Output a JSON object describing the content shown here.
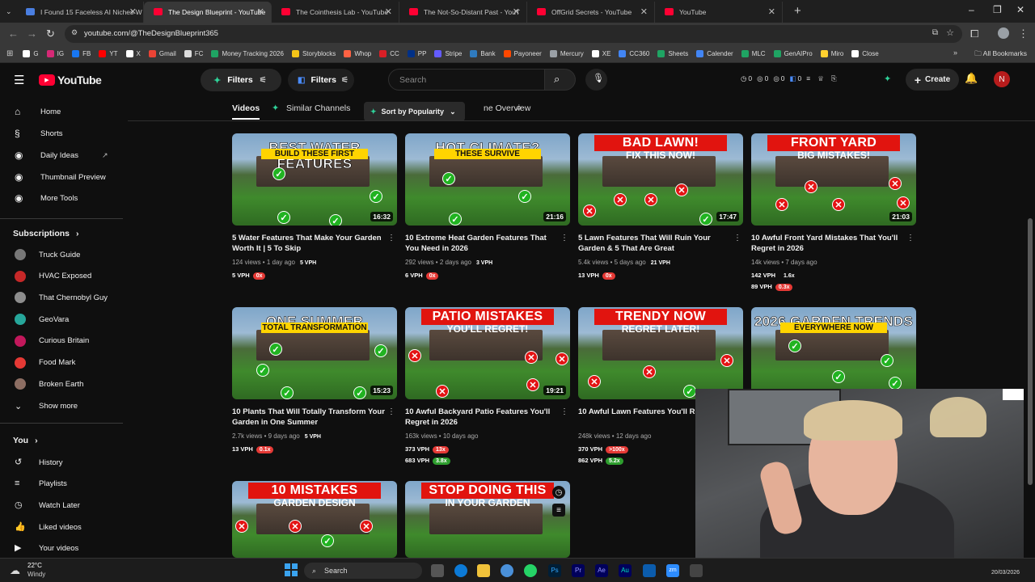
{
  "browser": {
    "tabs": [
      {
        "title": "I Found 15 Faceless AI Niches W",
        "active": false,
        "favicon": "doc-icon"
      },
      {
        "title": "The Design Blueprint - YouTube",
        "active": true,
        "favicon": "youtube-icon"
      },
      {
        "title": "The Cointhesis Lab - YouTube",
        "active": false,
        "favicon": "youtube-icon"
      },
      {
        "title": "The Not-So-Distant Past - YouT",
        "active": false,
        "favicon": "youtube-icon"
      },
      {
        "title": "OffGrid Secrets - YouTube",
        "active": false,
        "favicon": "youtube-icon"
      },
      {
        "title": "YouTube",
        "active": false,
        "favicon": "youtube-icon"
      }
    ],
    "url": "youtube.com/@TheDesignBlueprint365",
    "bookmarks": [
      {
        "label": "G",
        "color": "#ffffff"
      },
      {
        "label": "IG",
        "color": "#d62976"
      },
      {
        "label": "FB",
        "color": "#1877f2"
      },
      {
        "label": "YT",
        "color": "#ff0000"
      },
      {
        "label": "X",
        "color": "#ffffff"
      },
      {
        "label": "Gmail",
        "color": "#ea4335"
      },
      {
        "label": "FC",
        "color": "#dddddd"
      },
      {
        "label": "Money Tracking 2026",
        "color": "#1fa463"
      },
      {
        "label": "Storyblocks",
        "color": "#f5c518"
      },
      {
        "label": "Whop",
        "color": "#ff6243"
      },
      {
        "label": "CC",
        "color": "#da1f26"
      },
      {
        "label": "PP",
        "color": "#003087"
      },
      {
        "label": "Stripe",
        "color": "#635bff"
      },
      {
        "label": "Bank",
        "color": "#2f7bbf"
      },
      {
        "label": "Payoneer",
        "color": "#ff4800"
      },
      {
        "label": "Mercury",
        "color": "#9aa0a6"
      },
      {
        "label": "XE",
        "color": "#ffffff"
      },
      {
        "label": "CC360",
        "color": "#4285f4"
      },
      {
        "label": "Sheets",
        "color": "#1fa463"
      },
      {
        "label": "Calender",
        "color": "#4285f4"
      },
      {
        "label": "MLC",
        "color": "#1fa463"
      },
      {
        "label": "GenAIPro",
        "color": "#1fa463"
      },
      {
        "label": "Miro",
        "color": "#ffd02f"
      },
      {
        "label": "Close",
        "color": "#ffffff"
      }
    ],
    "all_bookmarks": "All Bookmarks"
  },
  "header": {
    "logo": "YouTube",
    "filters_a": "Filters",
    "filters_b": "Filters",
    "search_placeholder": "Search",
    "counters": [
      "0",
      "0",
      "0",
      "0"
    ],
    "create": "Create",
    "avatar_initial": "N"
  },
  "sidebar": {
    "main": [
      {
        "label": "Home",
        "icon": "home-icon"
      },
      {
        "label": "Shorts",
        "icon": "shorts-icon"
      },
      {
        "label": "Daily Ideas",
        "icon": "ideas-icon"
      },
      {
        "label": "Thumbnail Preview",
        "icon": "thumbnail-icon"
      },
      {
        "label": "More Tools",
        "icon": "tools-icon"
      }
    ],
    "subscriptions_title": "Subscriptions",
    "subscriptions": [
      {
        "label": "Truck Guide",
        "color": "#777777"
      },
      {
        "label": "HVAC Exposed",
        "color": "#c62828"
      },
      {
        "label": "That Chernobyl Guy",
        "color": "#8d8d8d"
      },
      {
        "label": "GeoVara",
        "color": "#26a69a"
      },
      {
        "label": "Curious Britain",
        "color": "#c2185b"
      },
      {
        "label": "Food Mark",
        "color": "#e53935"
      },
      {
        "label": "Broken Earth",
        "color": "#8d6e63"
      }
    ],
    "show_more": "Show more",
    "you_title": "You",
    "you_items": [
      {
        "label": "History",
        "icon": "history-icon"
      },
      {
        "label": "Playlists",
        "icon": "playlists-icon"
      },
      {
        "label": "Watch Later",
        "icon": "watch-later-icon"
      },
      {
        "label": "Liked videos",
        "icon": "like-icon"
      },
      {
        "label": "Your videos",
        "icon": "your-videos-icon"
      }
    ]
  },
  "channel_tabs": {
    "videos": "Videos",
    "similar": "Similar Channels",
    "sort": "Sort by Popularity",
    "overview": "ne Overview"
  },
  "videos": [
    {
      "headline1": "BEST WATER FEATURES",
      "headline2": "BUILD THESE FIRST",
      "duration": "16:32",
      "title": "5 Water Features That Make Your Garden Worth It | 5 To Skip",
      "views": "124 views",
      "age": "1 day ago",
      "vph": "5 VPH",
      "stats": [
        {
          "text": "5 VPH",
          "badge": "0x",
          "badge_color": "red"
        }
      ]
    },
    {
      "headline1": "HOT CLIMATE?",
      "headline2": "THESE SURVIVE",
      "duration": "21:16",
      "title": "10 Extreme Heat Garden Features That You Need in 2026",
      "views": "292 views",
      "age": "2 days ago",
      "vph": "3 VPH",
      "stats": [
        {
          "text": "6 VPH",
          "badge": "0x",
          "badge_color": "red"
        }
      ]
    },
    {
      "headline1": "BAD LAWN!",
      "headline2": "FIX THIS NOW!",
      "duration": "17:47",
      "title": "5 Lawn Features That Will Ruin Your Garden & 5 That Are Great",
      "views": "5.4k views",
      "age": "5 days ago",
      "vph": "21 VPH",
      "stats": [
        {
          "text": "13 VPH",
          "badge": "0x",
          "badge_color": "red"
        }
      ]
    },
    {
      "headline1": "FRONT YARD",
      "headline2": "BIG MISTAKES!",
      "duration": "21:03",
      "title": "10 Awful Front Yard Mistakes That You'll Regret in 2026",
      "views": "14k views",
      "age": "7 days ago",
      "vph": "",
      "stats": [
        {
          "text": "142 VPH",
          "badge": "1.6x",
          "badge_color": "plain"
        },
        {
          "text": "89 VPH",
          "badge": "0.3x",
          "badge_color": "red"
        }
      ]
    },
    {
      "headline1": "ONE SUMMER",
      "headline2": "TOTAL TRANSFORMATION",
      "duration": "15:23",
      "title": "10 Plants That Will Totally Transform Your Garden in One Summer",
      "views": "2.7k views",
      "age": "9 days ago",
      "vph": "5 VPH",
      "stats": [
        {
          "text": "13 VPH",
          "badge": "0.1x",
          "badge_color": "red"
        }
      ]
    },
    {
      "headline1": "PATIO MISTAKES",
      "headline2": "YOU'LL REGRET!",
      "duration": "19:21",
      "title": "10 Awful Backyard Patio Features You'll Regret in 2026",
      "views": "163k views",
      "age": "10 days ago",
      "vph": "",
      "stats": [
        {
          "text": "373 VPH",
          "badge": "13x",
          "badge_color": "red"
        },
        {
          "text": "683 VPH",
          "badge": "3.8x",
          "badge_color": "green"
        }
      ]
    },
    {
      "headline1": "TRENDY NOW",
      "headline2": "REGRET LATER!",
      "duration": "",
      "title": "10 Awful Lawn Features You'll Regre 2026",
      "views": "248k views",
      "age": "12 days ago",
      "vph": "",
      "stats": [
        {
          "text": "370 VPH",
          "badge": ">100x",
          "badge_color": "red"
        },
        {
          "text": "862 VPH",
          "badge": "5.2x",
          "badge_color": "green"
        }
      ]
    },
    {
      "headline1": "2026 GARDEN TRENDS",
      "headline2": "EVERYWHERE NOW",
      "duration": "",
      "title": "",
      "views": "",
      "age": "",
      "vph": "",
      "stats": []
    },
    {
      "headline1": "10 MISTAKES",
      "headline2": "GARDEN DESIGN",
      "duration": "",
      "title": "",
      "views": "",
      "age": "",
      "vph": "",
      "stats": []
    },
    {
      "headline1": "STOP DOING THIS",
      "headline2": "IN YOUR GARDEN",
      "duration": "",
      "title": "",
      "views": "",
      "age": "",
      "vph": "",
      "stats": []
    }
  ],
  "taskbar": {
    "weather_temp": "22°C",
    "weather_desc": "Windy",
    "search": "Search",
    "date": "20/03/2026"
  }
}
